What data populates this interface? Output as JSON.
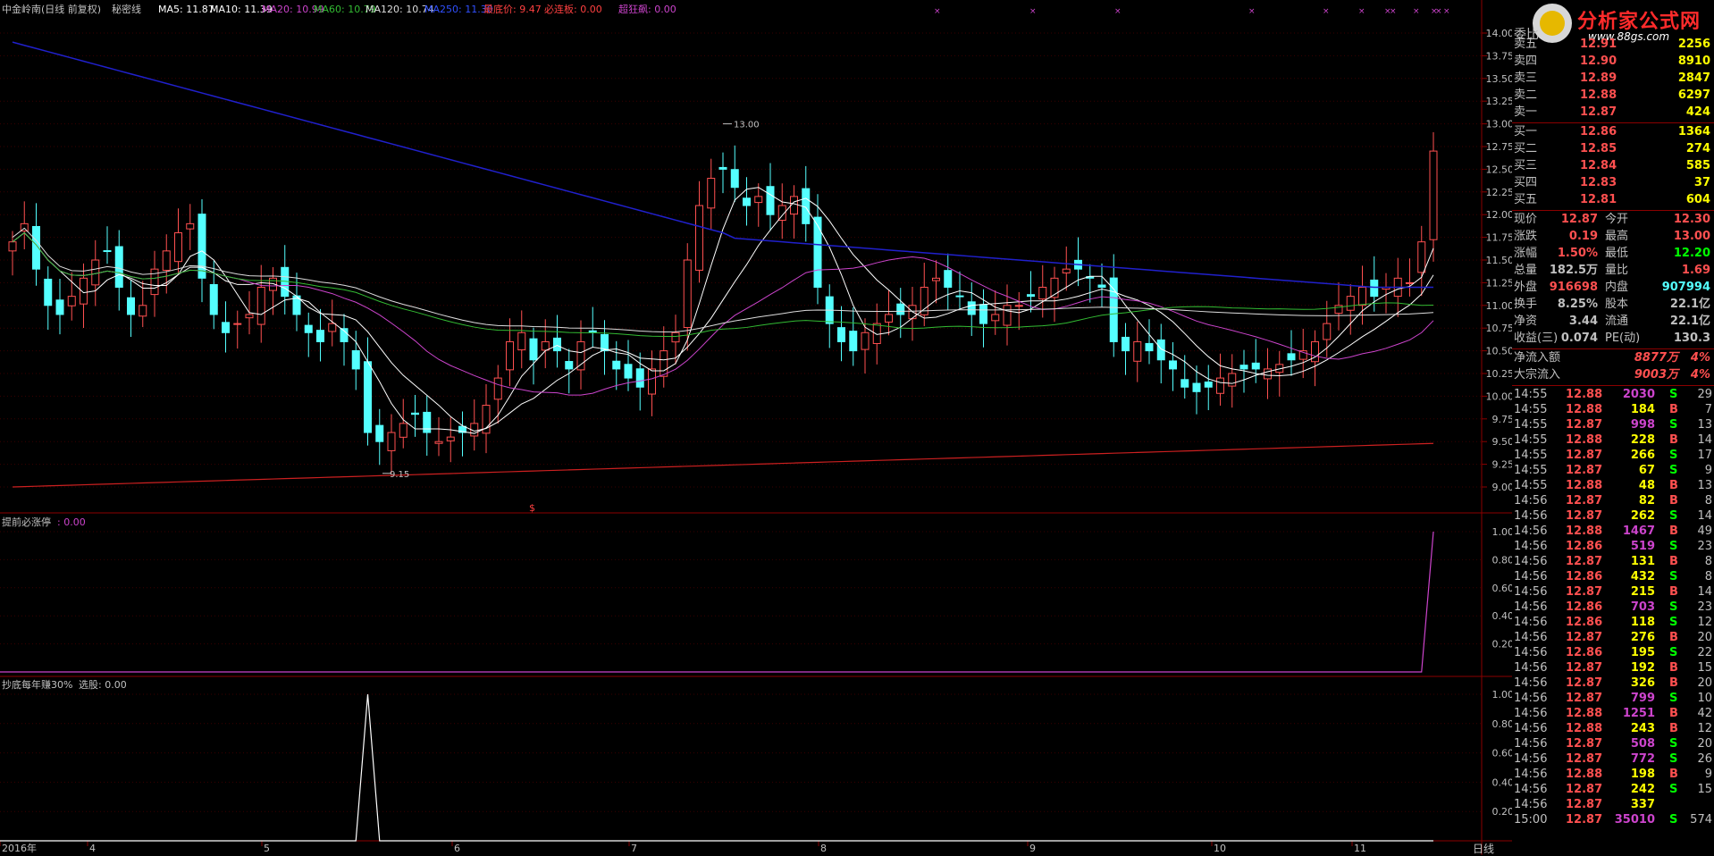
{
  "header": {
    "stock_name": "中金岭南(日线 前复权)",
    "formula": "秘密线",
    "ma5": "MA5: 11.87",
    "ma10": "MA10: 11.39",
    "ma20": "MA20: 10.99",
    "ma60": "MA60: 10.79",
    "ma120": "MA120: 10.74",
    "ma250": "MA250: 11.30",
    "lowest": "最底价: 9.47",
    "must_limit": "必连板: 0.00",
    "super_fast": "超狂飙: 0.00"
  },
  "sub1": {
    "label": "提前必涨停",
    "value": ": 0.00",
    "ticks": [
      "1.00",
      "0.80",
      "0.60",
      "0.40",
      "0.20"
    ]
  },
  "sub2": {
    "label": "抄底每年赚30%",
    "value": "选股: 0.00",
    "ticks": [
      "1.00",
      "0.80",
      "0.60",
      "0.40",
      "0.20"
    ]
  },
  "annotations": {
    "high": "13.00",
    "low": "9.15",
    "marker": "$"
  },
  "x_labels": [
    "2016年",
    "4",
    "5",
    "6",
    "7",
    "8",
    "9",
    "10",
    "11"
  ],
  "period_label": "日线",
  "logo": {
    "title": "分析家公式网",
    "url": "www.88gs.com"
  },
  "colors": {
    "up": "#ff5050",
    "down": "#54ffff",
    "ma5": "#ffffff",
    "ma10": "#ffffff",
    "ma20": "#cc44cc",
    "ma60": "#33bb33",
    "ma120": "#dddddd",
    "ma250": "#2020cc",
    "base": "#cc2020"
  },
  "chart_data": {
    "type": "candlestick",
    "y_ticks": [
      "14.00",
      "13.75",
      "13.50",
      "13.25",
      "13.00",
      "12.75",
      "12.50",
      "12.25",
      "12.00",
      "11.75",
      "11.50",
      "11.25",
      "11.00",
      "10.75",
      "10.50",
      "10.25",
      "10.00",
      "9.75",
      "9.50",
      "9.25",
      "9.00"
    ],
    "ylim": [
      9.0,
      14.0
    ],
    "close_series": [
      11.7,
      11.9,
      11.4,
      11.0,
      10.9,
      11.1,
      11.3,
      11.5,
      11.6,
      11.2,
      10.9,
      11.0,
      11.4,
      11.6,
      11.8,
      11.9,
      11.3,
      10.9,
      10.7,
      10.8,
      10.9,
      11.2,
      11.3,
      11.1,
      10.9,
      10.7,
      10.6,
      10.8,
      10.6,
      10.3,
      9.6,
      9.5,
      9.6,
      9.7,
      9.8,
      9.6,
      9.5,
      9.55,
      9.6,
      9.7,
      9.9,
      10.2,
      10.6,
      10.7,
      10.4,
      10.6,
      10.5,
      10.3,
      10.6,
      10.7,
      10.5,
      10.3,
      10.2,
      10.1,
      10.3,
      10.5,
      10.7,
      11.5,
      12.1,
      12.4,
      12.5,
      12.3,
      12.1,
      12.2,
      12.0,
      12.1,
      12.2,
      11.9,
      11.2,
      10.8,
      10.6,
      10.5,
      10.7,
      10.8,
      10.9,
      10.9,
      11.0,
      11.2,
      11.3,
      11.2,
      11.1,
      10.9,
      10.8,
      10.9,
      11.0,
      11.0,
      11.1,
      11.2,
      11.3,
      11.4,
      11.4,
      11.3,
      11.2,
      10.6,
      10.5,
      10.6,
      10.5,
      10.4,
      10.3,
      10.1,
      10.05,
      10.1,
      10.2,
      10.25,
      10.3,
      10.3,
      10.3,
      10.35,
      10.4,
      10.5,
      10.6,
      10.8,
      11.0,
      11.1,
      11.2,
      11.1,
      11.2,
      11.3,
      11.25,
      11.7,
      12.7
    ],
    "sub2_spike_index": 30,
    "sub1_spike_index": 120
  },
  "right_panel": {
    "weibi_label": "委比",
    "sell": [
      {
        "label": "卖五",
        "price": "12.91",
        "vol": "2256"
      },
      {
        "label": "卖四",
        "price": "12.90",
        "vol": "8910"
      },
      {
        "label": "卖三",
        "price": "12.89",
        "vol": "2847"
      },
      {
        "label": "卖二",
        "price": "12.88",
        "vol": "6297"
      },
      {
        "label": "卖一",
        "price": "12.87",
        "vol": "424"
      }
    ],
    "buy": [
      {
        "label": "买一",
        "price": "12.86",
        "vol": "1364"
      },
      {
        "label": "买二",
        "price": "12.85",
        "vol": "274"
      },
      {
        "label": "买三",
        "price": "12.84",
        "vol": "585"
      },
      {
        "label": "买四",
        "price": "12.83",
        "vol": "37"
      },
      {
        "label": "买五",
        "price": "12.81",
        "vol": "604"
      }
    ],
    "stats": [
      {
        "l1": "现价",
        "v1": "12.87",
        "l2": "今开",
        "v2": "12.30",
        "c1": "#ff5050",
        "c2": "#ff5050"
      },
      {
        "l1": "涨跌",
        "v1": "0.19",
        "l2": "最高",
        "v2": "13.00",
        "c1": "#ff5050",
        "c2": "#ff5050"
      },
      {
        "l1": "涨幅",
        "v1": "1.50%",
        "l2": "最低",
        "v2": "12.20",
        "c1": "#ff5050",
        "c2": "#00ff00"
      },
      {
        "l1": "总量",
        "v1": "182.5万",
        "l2": "量比",
        "v2": "1.69",
        "c1": "#c0c0c0",
        "c2": "#ff5050"
      },
      {
        "l1": "外盘",
        "v1": "916698",
        "l2": "内盘",
        "v2": "907994",
        "c1": "#ff5050",
        "c2": "#54ffff"
      },
      {
        "l1": "换手",
        "v1": "8.25%",
        "l2": "股本",
        "v2": "22.1亿",
        "c1": "#c0c0c0",
        "c2": "#c0c0c0"
      },
      {
        "l1": "净资",
        "v1": "3.44",
        "l2": "流通",
        "v2": "22.1亿",
        "c1": "#c0c0c0",
        "c2": "#c0c0c0"
      },
      {
        "l1": "收益(三)",
        "v1": "0.074",
        "l2": "PE(动)",
        "v2": "130.3",
        "c1": "#c0c0c0",
        "c2": "#c0c0c0"
      }
    ],
    "flows": [
      {
        "label": "净流入额",
        "value": "8877万",
        "pct": "4%"
      },
      {
        "label": "大宗流入",
        "value": "9003万",
        "pct": "4%"
      }
    ],
    "trades": [
      [
        "14:55",
        "12.88",
        "2030",
        "S",
        "29"
      ],
      [
        "14:55",
        "12.88",
        "184",
        "B",
        "7"
      ],
      [
        "14:55",
        "12.87",
        "998",
        "S",
        "13"
      ],
      [
        "14:55",
        "12.88",
        "228",
        "B",
        "14"
      ],
      [
        "14:55",
        "12.87",
        "266",
        "S",
        "17"
      ],
      [
        "14:55",
        "12.87",
        "67",
        "S",
        "9"
      ],
      [
        "14:55",
        "12.88",
        "48",
        "B",
        "13"
      ],
      [
        "14:56",
        "12.87",
        "82",
        "B",
        "8"
      ],
      [
        "14:56",
        "12.87",
        "262",
        "S",
        "14"
      ],
      [
        "14:56",
        "12.88",
        "1467",
        "B",
        "49"
      ],
      [
        "14:56",
        "12.86",
        "519",
        "S",
        "23"
      ],
      [
        "14:56",
        "12.87",
        "131",
        "B",
        "8"
      ],
      [
        "14:56",
        "12.86",
        "432",
        "S",
        "8"
      ],
      [
        "14:56",
        "12.87",
        "215",
        "B",
        "14"
      ],
      [
        "14:56",
        "12.86",
        "703",
        "S",
        "23"
      ],
      [
        "14:56",
        "12.86",
        "118",
        "S",
        "12"
      ],
      [
        "14:56",
        "12.87",
        "276",
        "B",
        "20"
      ],
      [
        "14:56",
        "12.86",
        "195",
        "S",
        "22"
      ],
      [
        "14:56",
        "12.87",
        "192",
        "B",
        "15"
      ],
      [
        "14:56",
        "12.87",
        "326",
        "B",
        "20"
      ],
      [
        "14:56",
        "12.87",
        "799",
        "S",
        "10"
      ],
      [
        "14:56",
        "12.88",
        "1251",
        "B",
        "42"
      ],
      [
        "14:56",
        "12.88",
        "243",
        "B",
        "12"
      ],
      [
        "14:56",
        "12.87",
        "508",
        "S",
        "20"
      ],
      [
        "14:56",
        "12.87",
        "772",
        "S",
        "26"
      ],
      [
        "14:56",
        "12.88",
        "198",
        "B",
        "9"
      ],
      [
        "14:56",
        "12.87",
        "242",
        "S",
        "15"
      ],
      [
        "14:56",
        "12.87",
        "337",
        "",
        ""
      ],
      [
        "15:00",
        "12.87",
        "35010",
        "S",
        "574"
      ]
    ]
  }
}
